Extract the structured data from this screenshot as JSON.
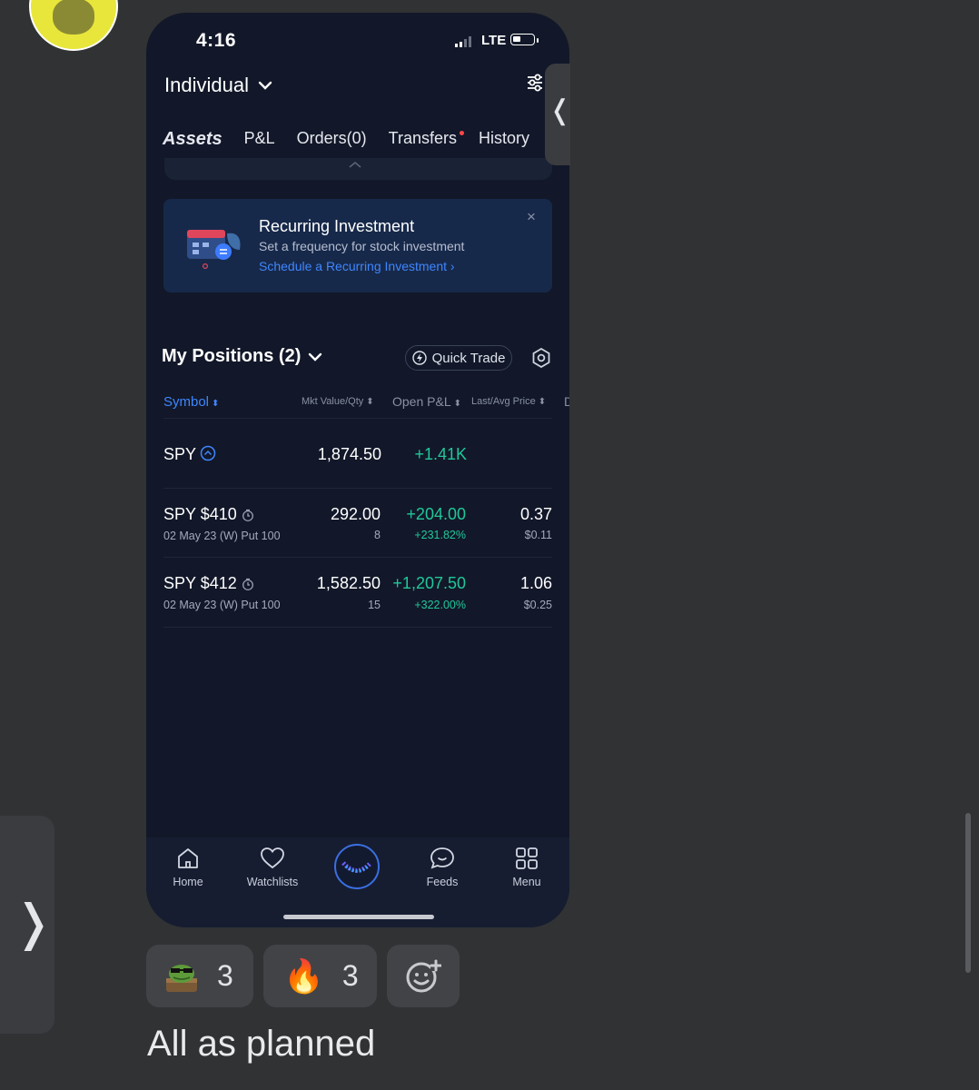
{
  "status_bar": {
    "time": "4:16",
    "network": "LTE"
  },
  "account": {
    "name": "Individual"
  },
  "tabs": [
    {
      "label": "Assets",
      "active": true
    },
    {
      "label": "P&L",
      "active": false
    },
    {
      "label": "Orders(0)",
      "active": false
    },
    {
      "label": "Transfers",
      "active": false,
      "dot": true
    },
    {
      "label": "History",
      "active": false
    }
  ],
  "banner": {
    "title": "Recurring Investment",
    "subtitle": "Set a frequency for stock investment",
    "link": "Schedule a Recurring Investment",
    "close": "×"
  },
  "positions": {
    "title": "My Positions (2)",
    "quick_trade": "Quick Trade",
    "columns": {
      "symbol": "Symbol",
      "mkt_value_qty": "Mkt Value/Qty",
      "open_pl": "Open P&L",
      "last_avg_price": "Last/Avg Price",
      "partial": "D"
    },
    "group": {
      "symbol": "SPY",
      "mkt_value": "1,874.50",
      "open_pl": "+1.41K"
    },
    "rows": [
      {
        "symbol": "SPY $410",
        "detail": "02 May 23 (W) Put 100",
        "mkt_value": "292.00",
        "qty": "8",
        "open_pl": "+204.00",
        "open_pl_pct": "+231.82%",
        "last": "0.37",
        "avg": "$0.11"
      },
      {
        "symbol": "SPY $412",
        "detail": "02 May 23 (W) Put 100",
        "mkt_value": "1,582.50",
        "qty": "15",
        "open_pl": "+1,207.50",
        "open_pl_pct": "+322.00%",
        "last": "1.06",
        "avg": "$0.25"
      }
    ]
  },
  "bottom_nav": [
    {
      "label": "Home",
      "icon": "home-icon"
    },
    {
      "label": "Watchlists",
      "icon": "heart-icon"
    },
    {
      "label": "",
      "icon": "center-logo-icon"
    },
    {
      "label": "Feeds",
      "icon": "chat-icon"
    },
    {
      "label": "Menu",
      "icon": "grid-icon"
    }
  ],
  "reactions": [
    {
      "emoji": "frog-sunglasses-emoji",
      "count": "3"
    },
    {
      "emoji": "🔥",
      "count": "3"
    }
  ],
  "message": {
    "text": "All as planned"
  },
  "colors": {
    "accent": "#3f86ff",
    "positive": "#21c79a",
    "phone_bg": "#121829",
    "chat_bg": "#313234"
  }
}
